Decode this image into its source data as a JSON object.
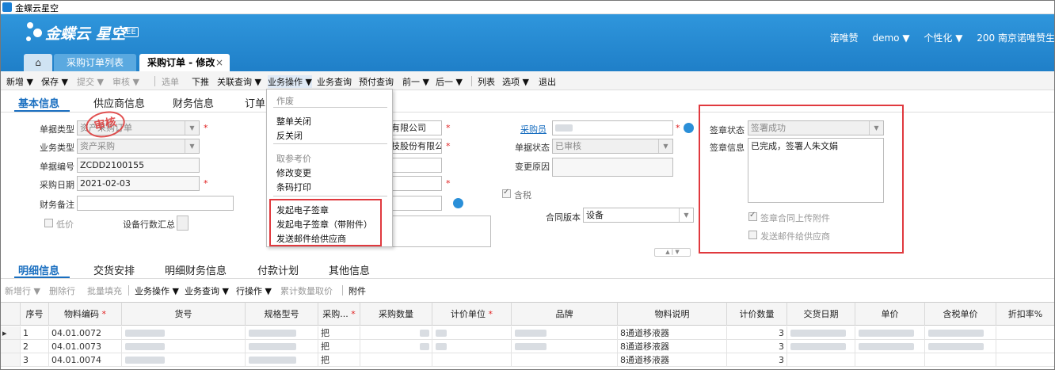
{
  "window": {
    "title": "金蝶云星空"
  },
  "header": {
    "logo_text": "金蝶云 星空",
    "logo_badge": "EE",
    "user_name": "诺唯赞",
    "account": "demo ▼",
    "personalize": "个性化 ▼",
    "org": "200 南京诺唯赞生"
  },
  "tabs": {
    "home_icon": "home-icon",
    "list": "采购订单列表",
    "edit": "采购订单 - 修改",
    "close": "×"
  },
  "toolbar": {
    "new": "新增 ▼",
    "save": "保存 ▼",
    "submit": "提交 ▼",
    "audit": "审核 ▼",
    "select": "选单",
    "push": "下推",
    "related_query": "关联查询 ▼",
    "biz_ops": "业务操作 ▼",
    "biz_query": "业务查询",
    "prepay_query": "预付查询",
    "prev": "前一 ▼",
    "next": "后一 ▼",
    "list": "列表",
    "options": "选项 ▼",
    "exit": "退出"
  },
  "section_tabs": [
    "基本信息",
    "供应商信息",
    "财务信息",
    "订单"
  ],
  "form": {
    "doc_type_label": "单据类型",
    "doc_type_value": "资产采购订单",
    "biz_type_label": "业务类型",
    "biz_type_value": "资产采购",
    "doc_no_label": "单据编号",
    "doc_no_value": "ZCDD2100155",
    "purchase_date_label": "采购日期",
    "purchase_date_value": "2021-02-03",
    "finance_note_label": "财务备注",
    "low_price_label": "低价",
    "device_summary_label": "设备行数汇总",
    "supplier1": "有限公司",
    "supplier2": "技股份有限公",
    "buyer_label": "采购员",
    "doc_status_label": "单据状态",
    "doc_status_value": "已审核",
    "change_reason_label": "变更原因",
    "tax_label": "含税",
    "contract_version_label": "合同版本",
    "contract_version_value": "设备",
    "collapse": "▲ | ▼",
    "stamp_text": "审核"
  },
  "sign": {
    "status_label": "签章状态",
    "status_value": "签署成功",
    "info_label": "签章信息",
    "info_value": "已完成，签署人朱文娟",
    "upload_contract_label": "签章合同上传附件",
    "email_supplier_label": "发送邮件给供应商"
  },
  "menu": {
    "items": [
      "作废",
      "整单关闭",
      "反关闭",
      "取参考价",
      "修改变更",
      "条码打印",
      "发起电子签章",
      "发起电子签章（带附件）",
      "发送邮件给供应商"
    ]
  },
  "detail_tabs": [
    "明细信息",
    "交货安排",
    "明细财务信息",
    "付款计划",
    "其他信息"
  ],
  "detail_toolbar": {
    "add_row": "新增行 ▼",
    "delete_row": "删除行",
    "batch_fill": "批量填充",
    "biz_ops": "业务操作 ▼",
    "biz_query": "业务查询 ▼",
    "row_ops": "行操作 ▼",
    "cumulative": "累计数量取价",
    "attachment": "附件"
  },
  "grid": {
    "headers": [
      "序号",
      "物料编码",
      "货号",
      "规格型号",
      "采购...",
      "采购数量",
      "计价单位",
      "品牌",
      "物料说明",
      "计价数量",
      "交货日期",
      "单价",
      "含税单价",
      "折扣率%"
    ],
    "rows": [
      {
        "seq": "1",
        "code": "04.01.0072",
        "unit": "把",
        "desc": "8通道移液器",
        "qty": "3"
      },
      {
        "seq": "2",
        "code": "04.01.0073",
        "unit": "把",
        "desc": "8通道移液器",
        "qty": "3"
      },
      {
        "seq": "3",
        "code": "04.01.0074",
        "unit": "把",
        "desc": "8通道移液器",
        "qty": "3"
      }
    ]
  },
  "colors": {
    "accent": "#1a6fc0",
    "header": "#2a8fd8",
    "highlight": "#e0393e"
  }
}
